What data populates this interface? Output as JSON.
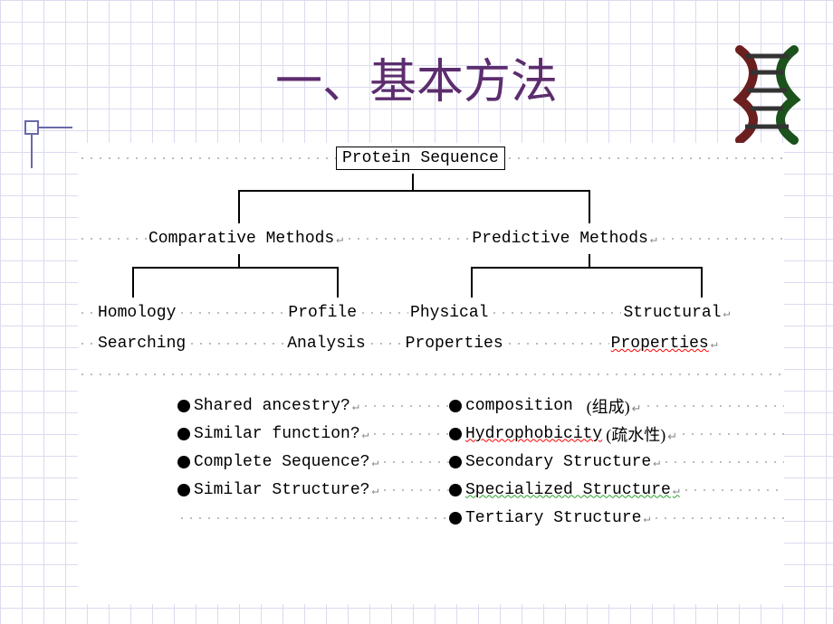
{
  "title": "一、基本方法",
  "diagram": {
    "root": "Protein Sequence",
    "left_branch": {
      "label": "Comparative Methods",
      "children": [
        {
          "line1": "Homology",
          "line2": "Searching"
        },
        {
          "line1": "Profile",
          "line2": "Analysis"
        }
      ]
    },
    "right_branch": {
      "label": "Predictive Methods",
      "children": [
        {
          "line1": "Physical",
          "line2": "Properties"
        },
        {
          "line1": "Structural",
          "line2": "Properties"
        }
      ]
    }
  },
  "bullets_left": [
    "Shared ancestry?",
    "Similar function?",
    "Complete Sequence?",
    "Similar Structure?"
  ],
  "bullets_right": [
    {
      "text": "composition",
      "note": "(组成)"
    },
    {
      "text": "Hydrophobicity",
      "note": "(疏水性)"
    },
    {
      "text": "Secondary Structure",
      "note": ""
    },
    {
      "text": "Specialized Structure",
      "note": ""
    },
    {
      "text": "Tertiary Structure",
      "note": ""
    }
  ]
}
